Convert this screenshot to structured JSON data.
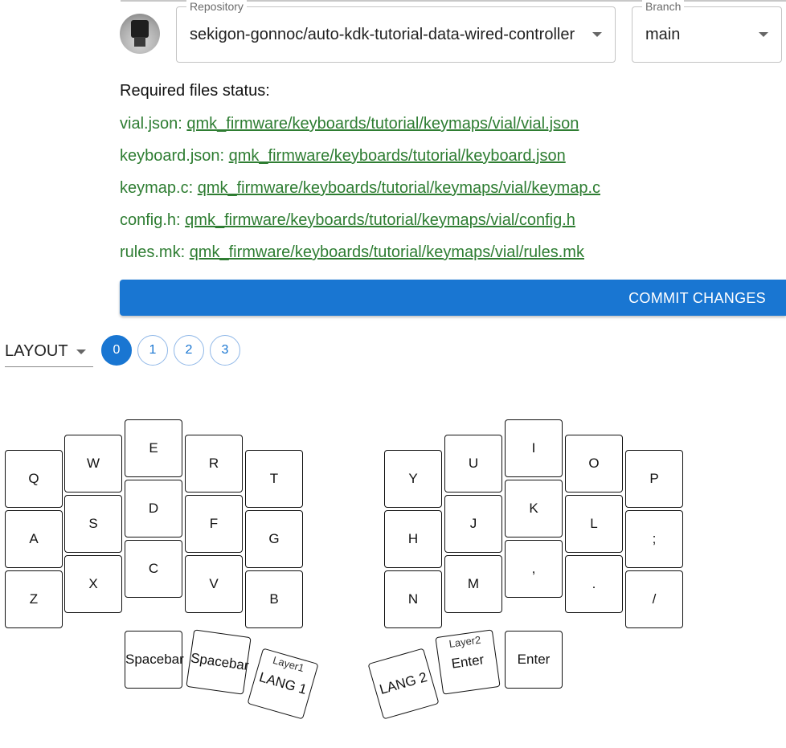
{
  "header": {
    "repository": {
      "label": "Repository",
      "value": "sekigon-gonnoc/auto-kdk-tutorial-data-wired-controller"
    },
    "branch": {
      "label": "Branch",
      "value": "main"
    }
  },
  "files": {
    "title": "Required files status:",
    "items": [
      {
        "name": "vial.json:",
        "path": "qmk_firmware/keyboards/tutorial/keymaps/vial/vial.json"
      },
      {
        "name": "keyboard.json:",
        "path": "qmk_firmware/keyboards/tutorial/keyboard.json"
      },
      {
        "name": "keymap.c:",
        "path": "qmk_firmware/keyboards/tutorial/keymaps/vial/keymap.c"
      },
      {
        "name": "config.h:",
        "path": "qmk_firmware/keyboards/tutorial/keymaps/vial/config.h"
      },
      {
        "name": "rules.mk:",
        "path": "qmk_firmware/keyboards/tutorial/keymaps/vial/rules.mk"
      }
    ],
    "status_color": "#2e7d32"
  },
  "commit_button": {
    "label": "COMMIT CHANGES",
    "color": "#1976d2"
  },
  "layout_select": {
    "value": "LAYOUT"
  },
  "layers": {
    "items": [
      "0",
      "1",
      "2",
      "3"
    ],
    "selected": "0"
  },
  "keys": {
    "q": "Q",
    "w": "W",
    "e": "E",
    "r": "R",
    "t": "T",
    "a": "A",
    "s": "S",
    "d": "D",
    "f": "F",
    "g": "G",
    "z": "Z",
    "x": "X",
    "c": "C",
    "v": "V",
    "b": "B",
    "y": "Y",
    "u": "U",
    "i": "I",
    "o": "O",
    "p": "P",
    "h": "H",
    "j": "J",
    "k": "K",
    "l": "L",
    "semicolon": ";",
    "n": "N",
    "m": "M",
    "comma": ",",
    "period": ".",
    "slash": "/",
    "space1": "Spacebar",
    "space2": "Spacebar",
    "lang1": {
      "label": "LANG 1",
      "sub": "Layer1"
    },
    "lang2": "LANG 2",
    "enter1": {
      "label": "Enter",
      "sub": "Layer2"
    },
    "enter2": "Enter"
  }
}
